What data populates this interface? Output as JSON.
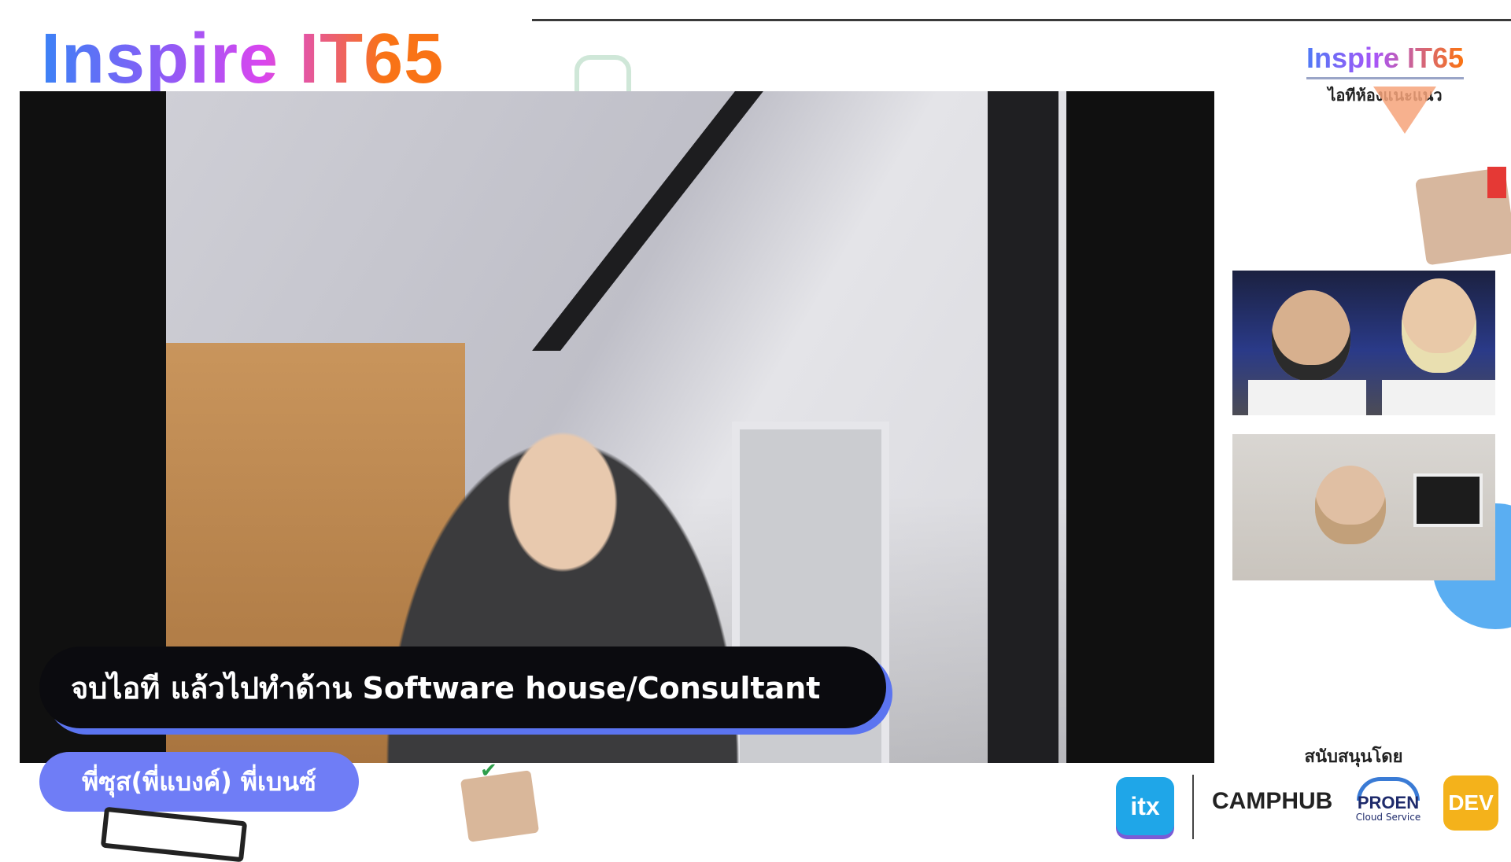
{
  "header": {
    "title": "Inspire IT65",
    "badge_title": "Inspire IT65",
    "badge_subtitle": "ไอทีห้องแนะแนว"
  },
  "main_video": {
    "caption": "จบไอที แล้วไปทำด้าน Software house/Consultant",
    "speaker_names": "พี่ซุส(พี่แบงค์)  พี่เบนซ์"
  },
  "side_videos": [
    {
      "label": "participant-video-1"
    },
    {
      "label": "participant-video-2"
    }
  ],
  "sponsors": {
    "label": "สนับสนุนโดย",
    "logos": [
      "itx",
      "CAMPHUB",
      "PROEN",
      "Cloud Service",
      "DEV"
    ]
  },
  "colors": {
    "caption_bg": "#0b0b0f",
    "caption_shadow": "#5b74f0",
    "name_pill": "#6f7df6",
    "title_gradient": [
      "#3b82f6",
      "#8b5cf6",
      "#d946ef",
      "#f97316"
    ]
  }
}
